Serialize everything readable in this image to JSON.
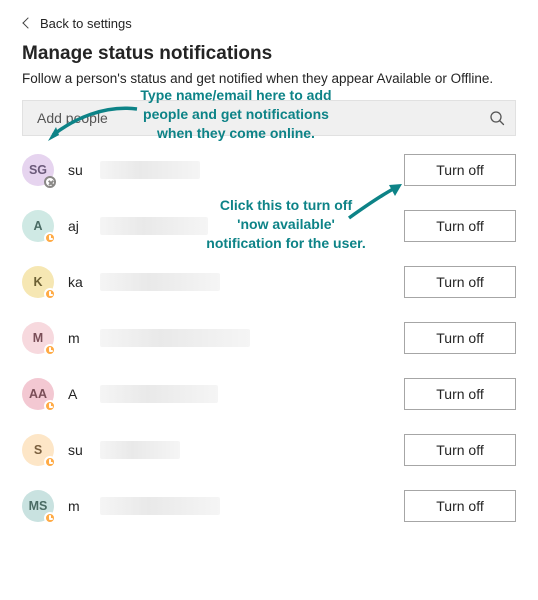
{
  "back_label": "Back to settings",
  "title": "Manage status notifications",
  "subtitle": "Follow a person's status and get notified when they appear Available or Offline.",
  "search": {
    "placeholder": "Add people"
  },
  "turn_off_label": "Turn off",
  "annotations": {
    "add": "Type name/email here to add people and get notifications when they come online.",
    "button": "Click this to turn off 'now available' notification for the user."
  },
  "people": [
    {
      "initials": "SG",
      "name_visible": "su",
      "avatar_bg": "#e6d4ef",
      "avatar_fg": "#6b5a7a",
      "presence": "offline",
      "blur_w": 100
    },
    {
      "initials": "A",
      "name_visible": "aj",
      "avatar_bg": "#cfe9e4",
      "avatar_fg": "#4a6b64",
      "presence": "away",
      "blur_w": 108
    },
    {
      "initials": "K",
      "name_visible": "ka",
      "avatar_bg": "#f6e7b3",
      "avatar_fg": "#6b5f33",
      "presence": "away",
      "blur_w": 120
    },
    {
      "initials": "M",
      "name_visible": "m",
      "avatar_bg": "#f7d9de",
      "avatar_fg": "#7a4e57",
      "presence": "away",
      "blur_w": 150
    },
    {
      "initials": "AA",
      "name_visible": "A",
      "avatar_bg": "#f3c8d2",
      "avatar_fg": "#7a4e57",
      "presence": "away",
      "blur_w": 118
    },
    {
      "initials": "S",
      "name_visible": "su",
      "avatar_bg": "#fde6c7",
      "avatar_fg": "#7a5f3e",
      "presence": "away",
      "blur_w": 80
    },
    {
      "initials": "MS",
      "name_visible": "m",
      "avatar_bg": "#c9e2e0",
      "avatar_fg": "#4a6b64",
      "presence": "away",
      "blur_w": 120
    }
  ]
}
